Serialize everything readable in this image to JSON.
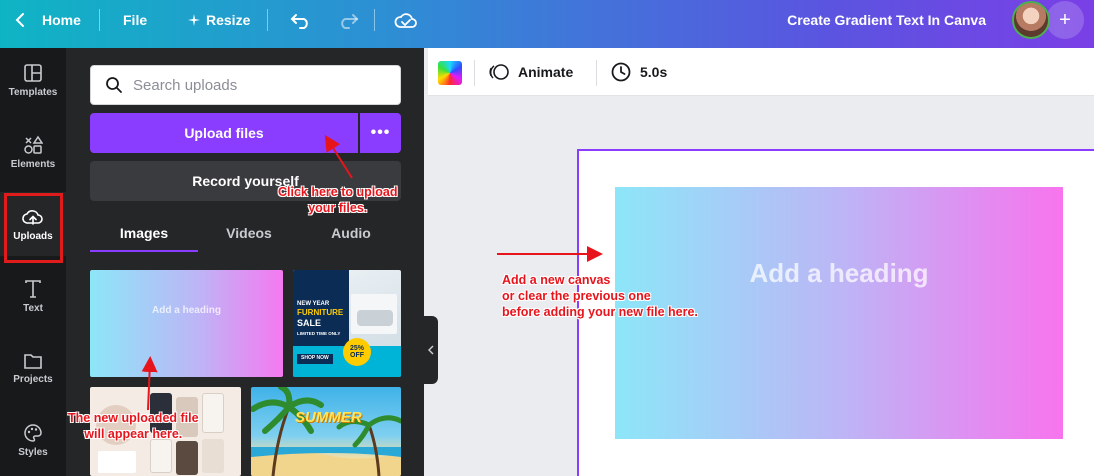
{
  "topbar": {
    "home_label": "Home",
    "file_label": "File",
    "resize_label": "Resize",
    "doc_title": "Create Gradient Text In Canva",
    "plus_label": "+"
  },
  "rail": {
    "items": [
      {
        "label": "Templates",
        "icon": "templates-icon"
      },
      {
        "label": "Elements",
        "icon": "elements-icon"
      },
      {
        "label": "Uploads",
        "icon": "upload-cloud-icon"
      },
      {
        "label": "Text",
        "icon": "text-icon"
      },
      {
        "label": "Projects",
        "icon": "folder-icon"
      },
      {
        "label": "Styles",
        "icon": "palette-icon"
      }
    ],
    "active": "Uploads"
  },
  "panel": {
    "search_placeholder": "Search uploads",
    "upload_label": "Upload files",
    "more_label": "•••",
    "record_label": "Record yourself",
    "tabs": [
      "Images",
      "Videos",
      "Audio"
    ],
    "active_tab": "Images",
    "thumb_gradient_text": "Add a heading",
    "furniture": {
      "line1": "NEW YEAR",
      "line2": "FURNITURE",
      "line3": "SALE",
      "line4": "LIMITED TIME ONLY",
      "shop": "SHOP NOW",
      "badge": "25% OFF"
    },
    "summer_text": "SUMMER"
  },
  "context_bar": {
    "animate_label": "Animate",
    "duration_label": "5.0s"
  },
  "canvas": {
    "heading_text": "Add a heading"
  },
  "annotations": {
    "upload_note_1": "Click here to upload",
    "upload_note_2": "your files.",
    "canvas_note_1": "Add a new canvas",
    "canvas_note_2": "or clear the previous one",
    "canvas_note_3": "before adding your new file here.",
    "thumb_note_1": "The new uploaded file",
    "thumb_note_2": "will appear here."
  },
  "colors": {
    "accent": "#8b3dff",
    "annotation_red": "#e8141c",
    "gradient_start": "#8de6f8",
    "gradient_end": "#f874ee"
  }
}
